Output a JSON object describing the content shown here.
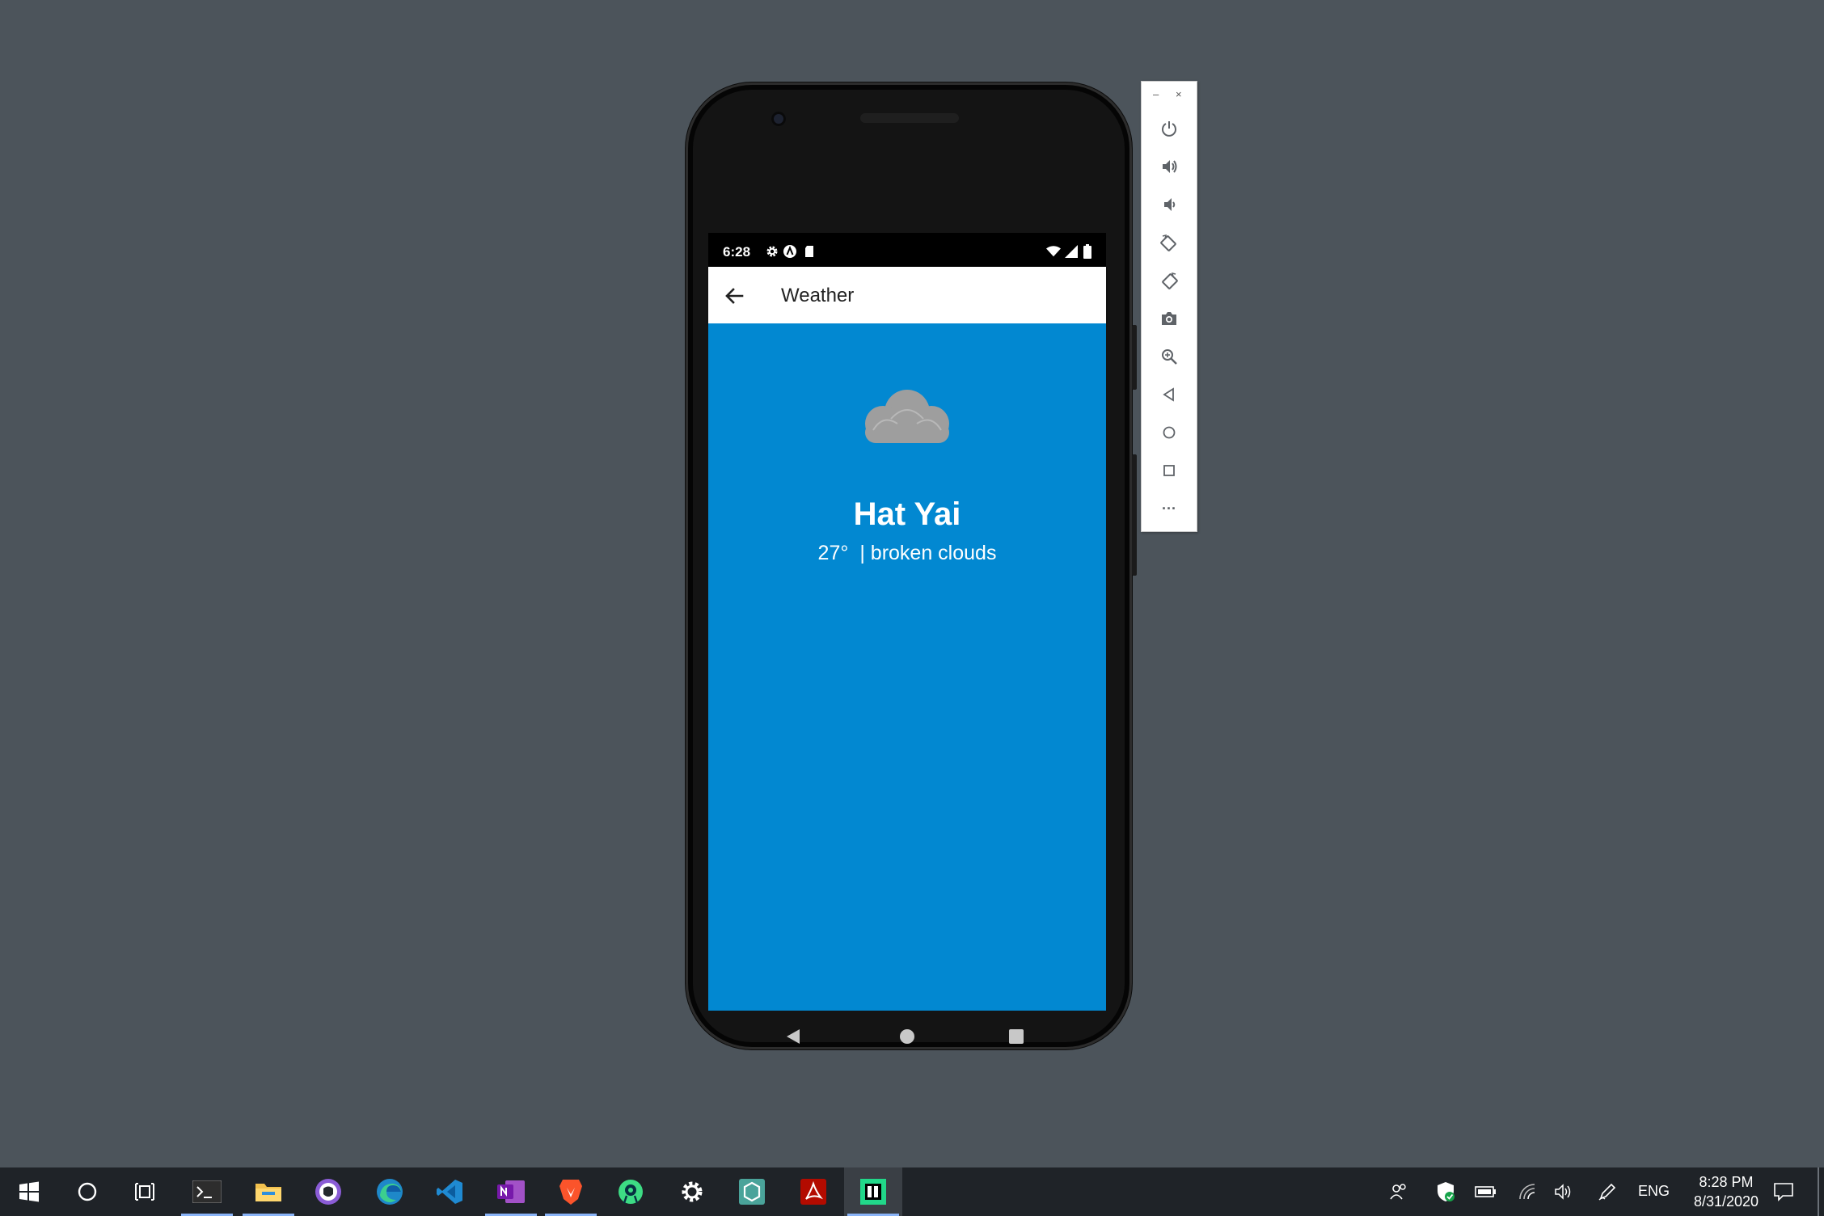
{
  "phone": {
    "status_bar": {
      "time": "6:28",
      "left_icons": [
        "gear-icon",
        "a-badge-icon",
        "sd-card-icon"
      ],
      "right_icons": [
        "wifi-icon",
        "signal-icon",
        "battery-icon"
      ]
    },
    "app_bar": {
      "back_icon": "arrow-left-icon",
      "title": "Weather"
    },
    "weather": {
      "icon": "cloud-icon",
      "city": "Hat Yai",
      "temperature": "27°",
      "description": "| broken clouds"
    },
    "nav_bar": [
      "back-triangle",
      "home-circle",
      "overview-square"
    ],
    "colors": {
      "content_bg": "#0288d1",
      "app_bar_bg": "#ffffff",
      "cloud": "#9e9e9e"
    }
  },
  "emulator_toolbar": {
    "window_controls": {
      "minimize": "–",
      "close": "×"
    },
    "buttons": [
      "power",
      "volume-up",
      "volume-down",
      "rotate-left",
      "rotate-right",
      "screenshot",
      "zoom",
      "back",
      "home",
      "overview",
      "more"
    ],
    "more_label": "···"
  },
  "taskbar": {
    "apps": [
      "windows-start",
      "search",
      "task-view",
      "terminal",
      "file-explorer",
      "github-desktop",
      "edge",
      "vscode",
      "onenote",
      "brave",
      "android-studio",
      "settings",
      "xamarin",
      "acrobat",
      "pycharm"
    ],
    "tray": {
      "language": "ENG",
      "time": "8:28 PM",
      "date": "8/31/2020"
    }
  }
}
